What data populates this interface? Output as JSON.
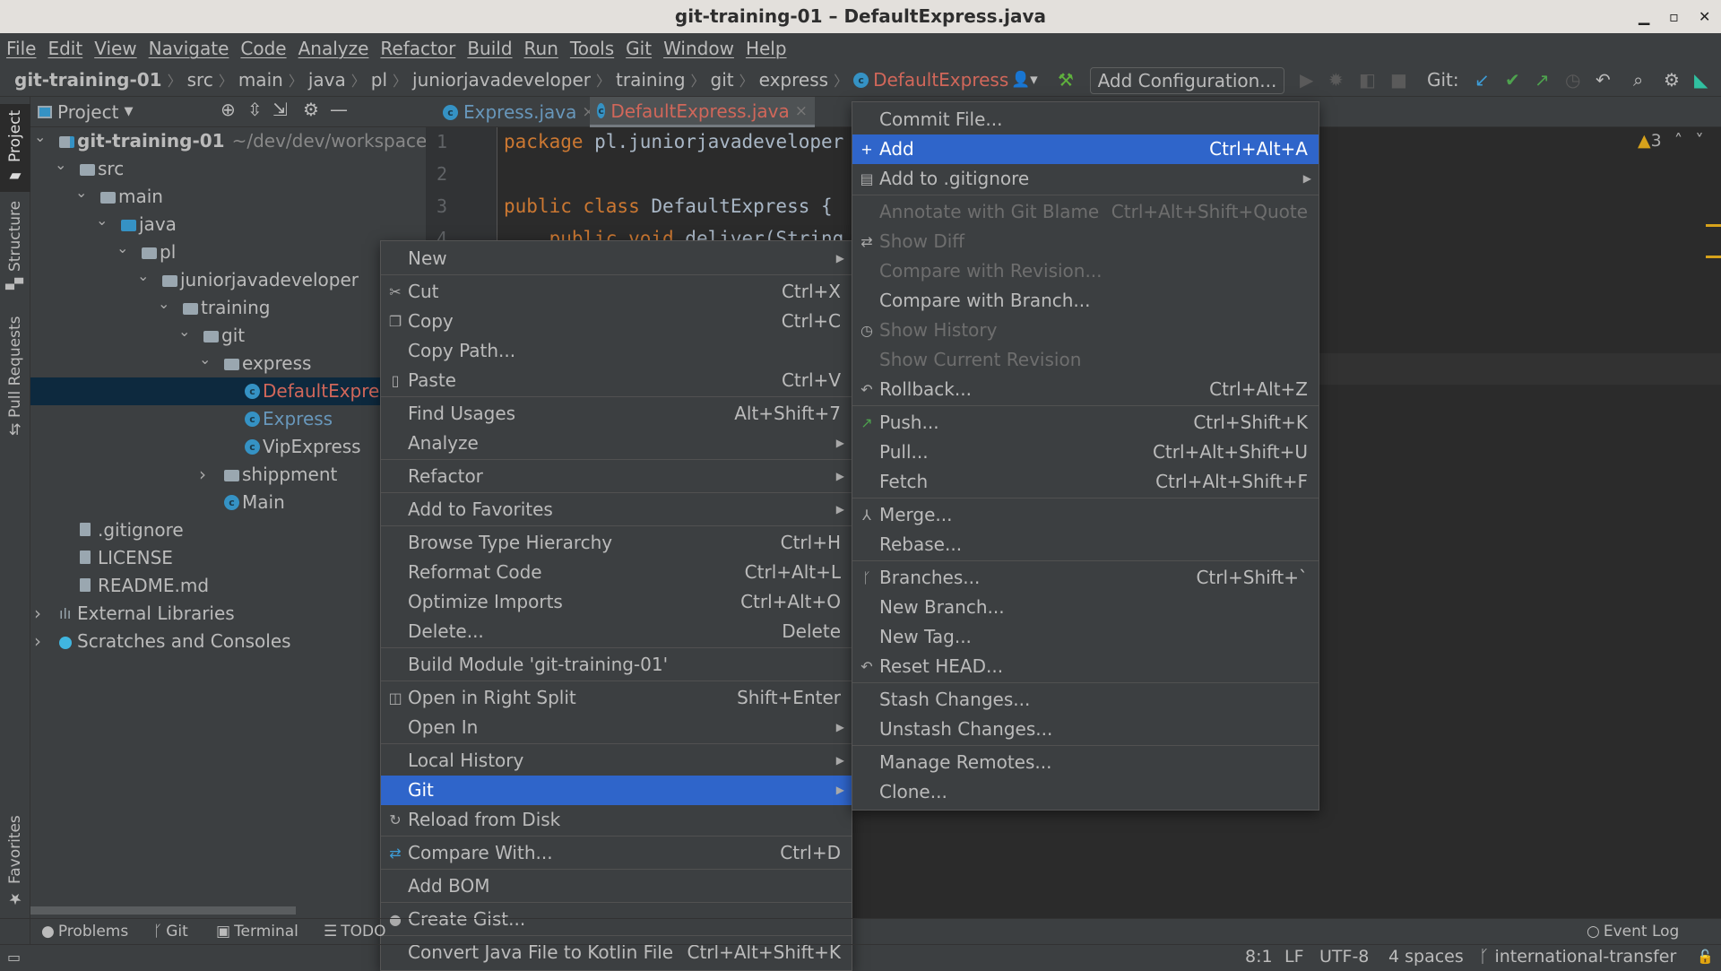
{
  "window": {
    "title": "git-training-01 – DefaultExpress.java"
  },
  "menubar": [
    "File",
    "Edit",
    "View",
    "Navigate",
    "Code",
    "Analyze",
    "Refactor",
    "Build",
    "Run",
    "Tools",
    "Git",
    "Window",
    "Help"
  ],
  "breadcrumb": [
    "git-training-01",
    "src",
    "main",
    "java",
    "pl",
    "juniorjavadeveloper",
    "training",
    "git",
    "express",
    "DefaultExpress"
  ],
  "toolbar": {
    "add_configuration": "Add Configuration...",
    "git_label": "Git:"
  },
  "colors": {
    "accent": "#2f65ca",
    "modified": "#6897bb",
    "untracked": "#d1675a",
    "tree_selection": "#0d293e"
  },
  "left_stripe": [
    "Project",
    "Structure",
    "Pull Requests",
    "Favorites"
  ],
  "project_panel": {
    "title": "Project",
    "tree": [
      {
        "label": "git-training-01",
        "suffix": "~/dev/dev/workspaces/E",
        "depth": 0,
        "type": "module",
        "expanded": true
      },
      {
        "label": "src",
        "depth": 1,
        "type": "folder",
        "expanded": true
      },
      {
        "label": "main",
        "depth": 2,
        "type": "folder",
        "expanded": true
      },
      {
        "label": "java",
        "depth": 3,
        "type": "src-folder",
        "expanded": true
      },
      {
        "label": "pl",
        "depth": 4,
        "type": "package",
        "expanded": true
      },
      {
        "label": "juniorjavadeveloper",
        "depth": 5,
        "type": "package",
        "expanded": true
      },
      {
        "label": "training",
        "depth": 6,
        "type": "package",
        "expanded": true
      },
      {
        "label": "git",
        "depth": 7,
        "type": "package",
        "expanded": true
      },
      {
        "label": "express",
        "depth": 8,
        "type": "package",
        "expanded": true
      },
      {
        "label": "DefaultExpress",
        "depth": 9,
        "type": "class",
        "status": "untracked",
        "selected": true
      },
      {
        "label": "Express",
        "depth": 9,
        "type": "class",
        "status": "modified"
      },
      {
        "label": "VipExpress",
        "depth": 9,
        "type": "class"
      },
      {
        "label": "shippment",
        "depth": 8,
        "type": "package",
        "expanded": false
      },
      {
        "label": "Main",
        "depth": 8,
        "type": "main-class"
      },
      {
        "label": ".gitignore",
        "depth": 1,
        "type": "file"
      },
      {
        "label": "LICENSE",
        "depth": 1,
        "type": "file"
      },
      {
        "label": "README.md",
        "depth": 1,
        "type": "md-file"
      },
      {
        "label": "External Libraries",
        "depth": 0,
        "type": "libraries",
        "expanded": false
      },
      {
        "label": "Scratches and Consoles",
        "depth": 0,
        "type": "scratches",
        "expanded": false
      }
    ]
  },
  "editor": {
    "tabs": [
      {
        "label": "Express.java",
        "status": "modified"
      },
      {
        "label": "DefaultExpress.java",
        "status": "untracked",
        "active": true
      }
    ],
    "lines": [
      {
        "n": "1",
        "kw": "package",
        "rest": " pl.juniorjavadeveloper"
      },
      {
        "n": "2",
        "kw": "",
        "rest": ""
      },
      {
        "n": "3",
        "kw": "public class",
        "rest": " DefaultExpress {"
      },
      {
        "n": "4",
        "kw": "    public void",
        "rest": " deliver(String"
      }
    ],
    "warnings": "3"
  },
  "context_menu": [
    {
      "label": "New",
      "submenu": true
    },
    {
      "sep": true
    },
    {
      "label": "Cut",
      "shortcut": "Ctrl+X",
      "icon": "✂"
    },
    {
      "label": "Copy",
      "shortcut": "Ctrl+C",
      "icon": "❐"
    },
    {
      "label": "Copy Path..."
    },
    {
      "label": "Paste",
      "shortcut": "Ctrl+V",
      "icon": "▯"
    },
    {
      "sep": true
    },
    {
      "label": "Find Usages",
      "shortcut": "Alt+Shift+7"
    },
    {
      "label": "Analyze",
      "submenu": true
    },
    {
      "sep": true
    },
    {
      "label": "Refactor",
      "submenu": true
    },
    {
      "sep": true
    },
    {
      "label": "Add to Favorites",
      "submenu": true
    },
    {
      "sep": true
    },
    {
      "label": "Browse Type Hierarchy",
      "shortcut": "Ctrl+H"
    },
    {
      "label": "Reformat Code",
      "shortcut": "Ctrl+Alt+L"
    },
    {
      "label": "Optimize Imports",
      "shortcut": "Ctrl+Alt+O"
    },
    {
      "label": "Delete...",
      "shortcut": "Delete"
    },
    {
      "sep": true
    },
    {
      "label": "Build Module 'git-training-01'"
    },
    {
      "sep": true
    },
    {
      "label": "Open in Right Split",
      "shortcut": "Shift+Enter",
      "icon": "◫"
    },
    {
      "label": "Open In",
      "submenu": true
    },
    {
      "sep": true
    },
    {
      "label": "Local History",
      "submenu": true
    },
    {
      "label": "Git",
      "submenu": true,
      "active": true
    },
    {
      "label": "Reload from Disk",
      "icon": "↻"
    },
    {
      "sep": true
    },
    {
      "label": "Compare With...",
      "shortcut": "Ctrl+D",
      "icon": "⇄"
    },
    {
      "sep": true
    },
    {
      "label": "Add BOM"
    },
    {
      "sep": true
    },
    {
      "label": "Create Gist...",
      "icon": "●"
    },
    {
      "sep": true
    },
    {
      "label": "Convert Java File to Kotlin File",
      "shortcut": "Ctrl+Alt+Shift+K"
    }
  ],
  "git_submenu": [
    {
      "label": "Commit File..."
    },
    {
      "label": "Add",
      "shortcut": "Ctrl+Alt+A",
      "icon": "+",
      "active": true
    },
    {
      "label": "Add to .gitignore",
      "submenu": true,
      "icon": "▤"
    },
    {
      "sep": true
    },
    {
      "label": "Annotate with Git Blame",
      "shortcut": "Ctrl+Alt+Shift+Quote",
      "disabled": true
    },
    {
      "label": "Show Diff",
      "disabled": true,
      "icon": "⇄"
    },
    {
      "label": "Compare with Revision...",
      "disabled": true
    },
    {
      "label": "Compare with Branch..."
    },
    {
      "label": "Show History",
      "disabled": true,
      "icon": "◷"
    },
    {
      "label": "Show Current Revision",
      "disabled": true
    },
    {
      "label": "Rollback...",
      "shortcut": "Ctrl+Alt+Z",
      "icon": "↶"
    },
    {
      "sep": true
    },
    {
      "label": "Push...",
      "shortcut": "Ctrl+Shift+K",
      "icon": "↗"
    },
    {
      "label": "Pull...",
      "shortcut": "Ctrl+Alt+Shift+U"
    },
    {
      "label": "Fetch",
      "shortcut": "Ctrl+Alt+Shift+F"
    },
    {
      "sep": true
    },
    {
      "label": "Merge...",
      "icon": "⅄"
    },
    {
      "label": "Rebase..."
    },
    {
      "sep": true
    },
    {
      "label": "Branches...",
      "shortcut": "Ctrl+Shift+`",
      "icon": "ᚴ"
    },
    {
      "label": "New Branch..."
    },
    {
      "label": "New Tag..."
    },
    {
      "label": "Reset HEAD...",
      "icon": "↶"
    },
    {
      "sep": true
    },
    {
      "label": "Stash Changes..."
    },
    {
      "label": "Unstash Changes..."
    },
    {
      "sep": true
    },
    {
      "label": "Manage Remotes..."
    },
    {
      "label": "Clone..."
    }
  ],
  "bottom_tools": [
    "Problems",
    "Git",
    "Terminal",
    "TODO"
  ],
  "event_log": "Event Log",
  "status": {
    "position": "8:1",
    "line_sep": "LF",
    "encoding": "UTF-8",
    "indent": "4 spaces",
    "branch": "international-transfer"
  }
}
